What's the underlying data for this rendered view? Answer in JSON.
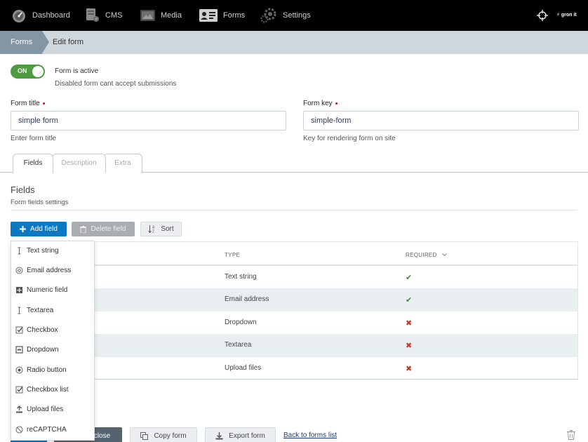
{
  "nav": {
    "items": [
      {
        "label": "Dashboard",
        "icon": "dashboard-gauge-icon"
      },
      {
        "label": "CMS",
        "icon": "cms-document-icon"
      },
      {
        "label": "Media",
        "icon": "media-image-icon"
      },
      {
        "label": "Forms",
        "icon": "forms-idcard-icon"
      },
      {
        "label": "Settings",
        "icon": "settings-gear-icon"
      }
    ],
    "brand": "⚡ gron it"
  },
  "breadcrumb": {
    "first": "Forms",
    "second": "Edit form"
  },
  "status": {
    "toggle_label": "ON",
    "title": "Form is active",
    "description": "Disabled form cant accept submissions"
  },
  "form": {
    "title_label": "Form title",
    "title_value": "simple form",
    "title_hint": "Enter form title",
    "key_label": "Form key",
    "key_value": "simple-form",
    "key_hint": "Key for rendering form on site",
    "required_marker": "•"
  },
  "tabs": [
    {
      "label": "Fields",
      "active": true
    },
    {
      "label": "Description",
      "active": false
    },
    {
      "label": "Extra",
      "active": false
    }
  ],
  "section": {
    "title": "Fields",
    "subtitle": "Form fields settings"
  },
  "toolbar": {
    "add_label": "Add field",
    "delete_label": "Delete field",
    "sort_label": "Sort"
  },
  "table": {
    "headers": {
      "type": "TYPE",
      "required": "REQUIRED"
    },
    "rows": [
      {
        "type": "Text string",
        "required": true,
        "mark": "✔"
      },
      {
        "type": "Email address",
        "required": true,
        "mark": "✔"
      },
      {
        "type": "Dropdown",
        "required": false,
        "mark": "✖"
      },
      {
        "type": "Textarea",
        "required": false,
        "mark": "✖"
      },
      {
        "type": "Upload files",
        "required": false,
        "mark": "✖"
      }
    ]
  },
  "add_menu": {
    "items": [
      {
        "label": "Text string",
        "icon": "text-cursor-icon"
      },
      {
        "label": "Email address",
        "icon": "at-sign-icon"
      },
      {
        "label": "Numeric field",
        "icon": "plus-box-icon"
      },
      {
        "label": "Textarea",
        "icon": "text-cursor-icon"
      },
      {
        "label": "Checkbox",
        "icon": "checkbox-icon"
      },
      {
        "label": "Dropdown",
        "icon": "dropdown-box-icon"
      },
      {
        "label": "Radio button",
        "icon": "radio-icon"
      },
      {
        "label": "Checkbox list",
        "icon": "checkbox-icon"
      },
      {
        "label": "Upload files",
        "icon": "upload-icon"
      },
      {
        "label": "reCAPTCHA",
        "icon": "captcha-icon"
      }
    ]
  },
  "footer": {
    "close_label": "close",
    "copy_label": "Copy form",
    "export_label": "Export form",
    "back_label": "Back to forms list"
  },
  "colors": {
    "nav_bg": "#000000",
    "primary": "#0d78c2",
    "toggle_on": "#4f9b40",
    "breadcrumb_active": "#8496a3",
    "required": "#d0021b"
  }
}
